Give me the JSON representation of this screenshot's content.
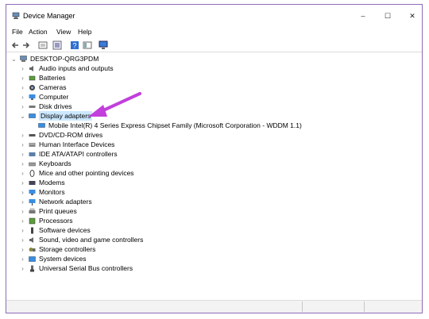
{
  "window": {
    "title": "Device Manager",
    "minimize_glyph": "–",
    "maximize_glyph": "☐",
    "close_glyph": "✕"
  },
  "menu": [
    "File",
    "Action",
    "View",
    "Help"
  ],
  "toolbar": {
    "icons": [
      "back-arrow-icon",
      "forward-arrow-icon",
      "properties-icon",
      "show-hidden-icon",
      "help-icon",
      "view-icon",
      "monitor-icon"
    ]
  },
  "tree": {
    "root": "DESKTOP-QRG3PDM",
    "items": [
      {
        "label": "Audio inputs and outputs",
        "expanded": false,
        "icon": "speaker-icon"
      },
      {
        "label": "Batteries",
        "expanded": false,
        "icon": "battery-icon"
      },
      {
        "label": "Cameras",
        "expanded": false,
        "icon": "camera-icon"
      },
      {
        "label": "Computer",
        "expanded": false,
        "icon": "computer-icon"
      },
      {
        "label": "Disk drives",
        "expanded": false,
        "icon": "disk-icon"
      },
      {
        "label": "Display adapters",
        "expanded": true,
        "selected": true,
        "icon": "display-icon"
      },
      {
        "label": "Mobile Intel(R) 4 Series Express Chipset Family (Microsoft Corporation - WDDM 1.1)",
        "child": true,
        "icon": "display-icon"
      },
      {
        "label": "DVD/CD-ROM drives",
        "expanded": false,
        "icon": "dvd-icon"
      },
      {
        "label": "Human Interface Devices",
        "expanded": false,
        "icon": "hid-icon"
      },
      {
        "label": "IDE ATA/ATAPI controllers",
        "expanded": false,
        "icon": "ide-icon"
      },
      {
        "label": "Keyboards",
        "expanded": false,
        "icon": "keyboard-icon"
      },
      {
        "label": "Mice and other pointing devices",
        "expanded": false,
        "icon": "mouse-icon"
      },
      {
        "label": "Modems",
        "expanded": false,
        "icon": "modem-icon"
      },
      {
        "label": "Monitors",
        "expanded": false,
        "icon": "monitor-icon"
      },
      {
        "label": "Network adapters",
        "expanded": false,
        "icon": "network-icon"
      },
      {
        "label": "Print queues",
        "expanded": false,
        "icon": "printer-icon"
      },
      {
        "label": "Processors",
        "expanded": false,
        "icon": "processor-icon"
      },
      {
        "label": "Software devices",
        "expanded": false,
        "icon": "software-icon"
      },
      {
        "label": "Sound, video and game controllers",
        "expanded": false,
        "icon": "sound-icon"
      },
      {
        "label": "Storage controllers",
        "expanded": false,
        "icon": "storage-icon"
      },
      {
        "label": "System devices",
        "expanded": false,
        "icon": "system-icon"
      },
      {
        "label": "Universal Serial Bus controllers",
        "expanded": false,
        "icon": "usb-icon"
      }
    ]
  },
  "colors": {
    "selection": "#cce8ff",
    "annotation_arrow": "#c23fdc",
    "window_border": "#8e6bb8"
  }
}
